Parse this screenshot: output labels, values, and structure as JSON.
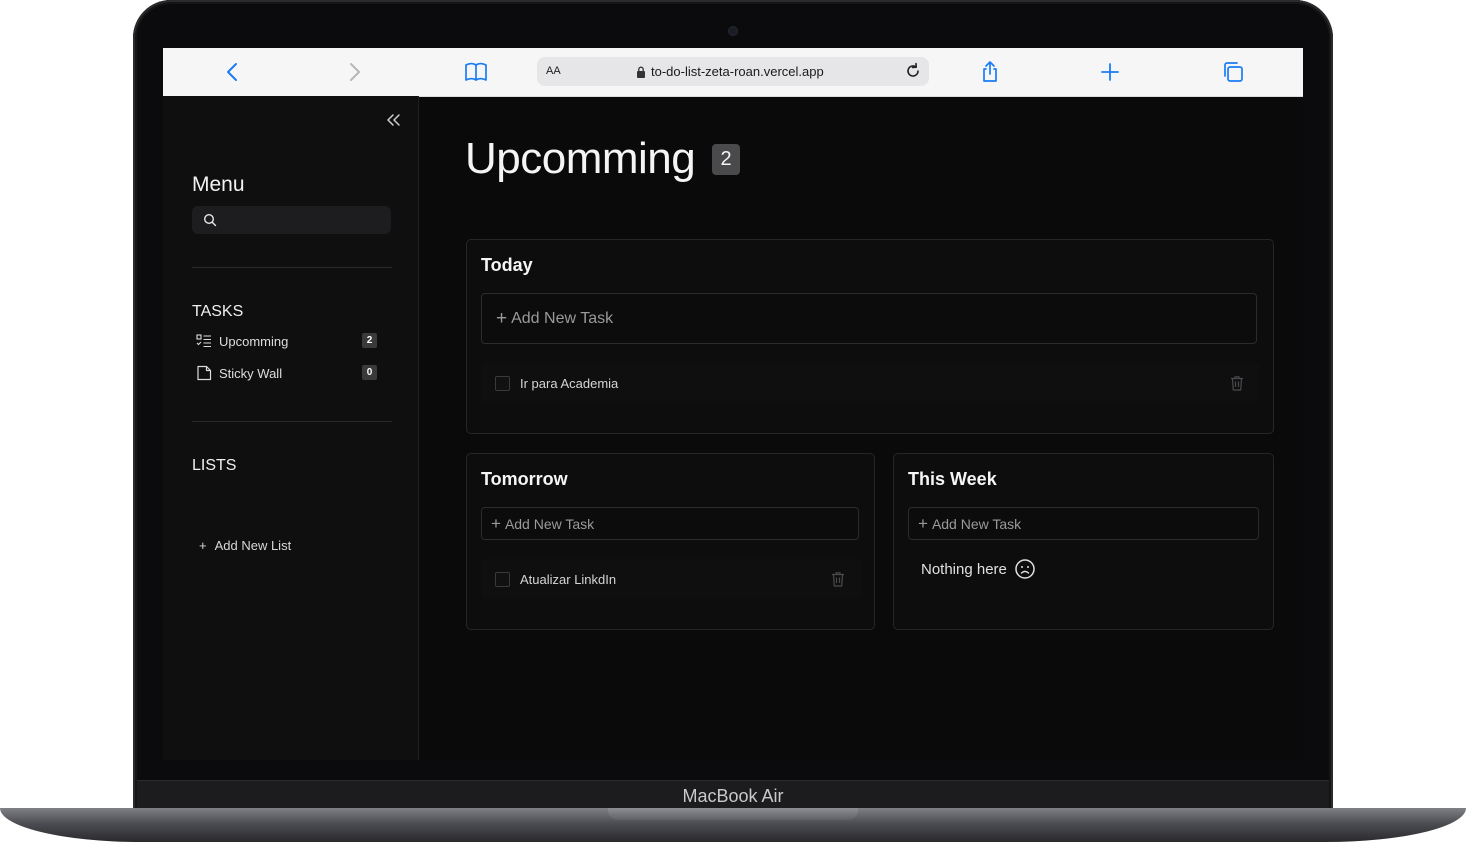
{
  "device": {
    "model": "MacBook Air"
  },
  "browser": {
    "text_size_label": "AA",
    "url": "to-do-list-zeta-roan.vercel.app",
    "accent": "#1a7cf5"
  },
  "sidebar": {
    "title": "Menu",
    "search_placeholder": "",
    "tasks_section": {
      "title": "TASKS",
      "items": [
        {
          "label": "Upcomming",
          "count": "2",
          "icon": "list-todo-icon"
        },
        {
          "label": "Sticky Wall",
          "count": "0",
          "icon": "sticky-note-icon"
        }
      ]
    },
    "lists_section": {
      "title": "LISTS",
      "add_label": "Add New List"
    }
  },
  "main": {
    "title": "Upcomming",
    "count": "2",
    "sections": {
      "today": {
        "title": "Today",
        "add_label": "Add New Task",
        "tasks": [
          {
            "label": "Ir para Academia",
            "done": false
          }
        ]
      },
      "tomorrow": {
        "title": "Tomorrow",
        "add_label": "Add New Task",
        "tasks": [
          {
            "label": "Atualizar LinkdIn",
            "done": false
          }
        ]
      },
      "this_week": {
        "title": "This Week",
        "add_label": "Add New Task",
        "empty_message": "Nothing here"
      }
    }
  }
}
